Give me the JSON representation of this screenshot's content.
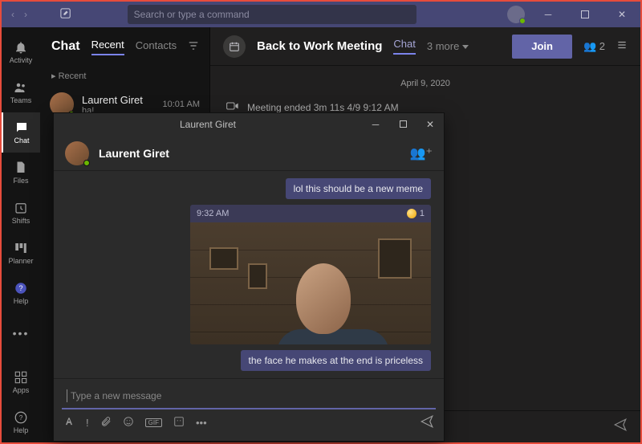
{
  "titlebar": {
    "search_placeholder": "Search or type a command"
  },
  "rail": {
    "items": [
      {
        "label": "Activity"
      },
      {
        "label": "Teams"
      },
      {
        "label": "Chat"
      },
      {
        "label": "Files"
      },
      {
        "label": "Shifts"
      },
      {
        "label": "Planner"
      },
      {
        "label": "Help"
      }
    ],
    "bottom": [
      {
        "label": "Apps"
      },
      {
        "label": "Help"
      }
    ]
  },
  "chatlist": {
    "title": "Chat",
    "tabs": {
      "recent": "Recent",
      "contacts": "Contacts"
    },
    "group": "Recent",
    "items": [
      {
        "name": "Laurent Giret",
        "preview": "ha!",
        "time": "10:01 AM"
      }
    ]
  },
  "conversation": {
    "title": "Back to Work Meeting",
    "tab_chat": "Chat",
    "tab_more": "3 more",
    "join": "Join",
    "participants": "2",
    "date": "April 9, 2020",
    "system_row": "Meeting ended   3m 11s   4/9 9:12 AM"
  },
  "popout": {
    "window_title": "Laurent Giret",
    "name": "Laurent Giret",
    "bubble_top": "lol this should be a new meme",
    "msg_time": "9:32 AM",
    "reaction_count": "1",
    "bubble_bottom": "the face he makes at the end is priceless",
    "compose_placeholder": "Type a new message",
    "gif_label": "GIF"
  }
}
